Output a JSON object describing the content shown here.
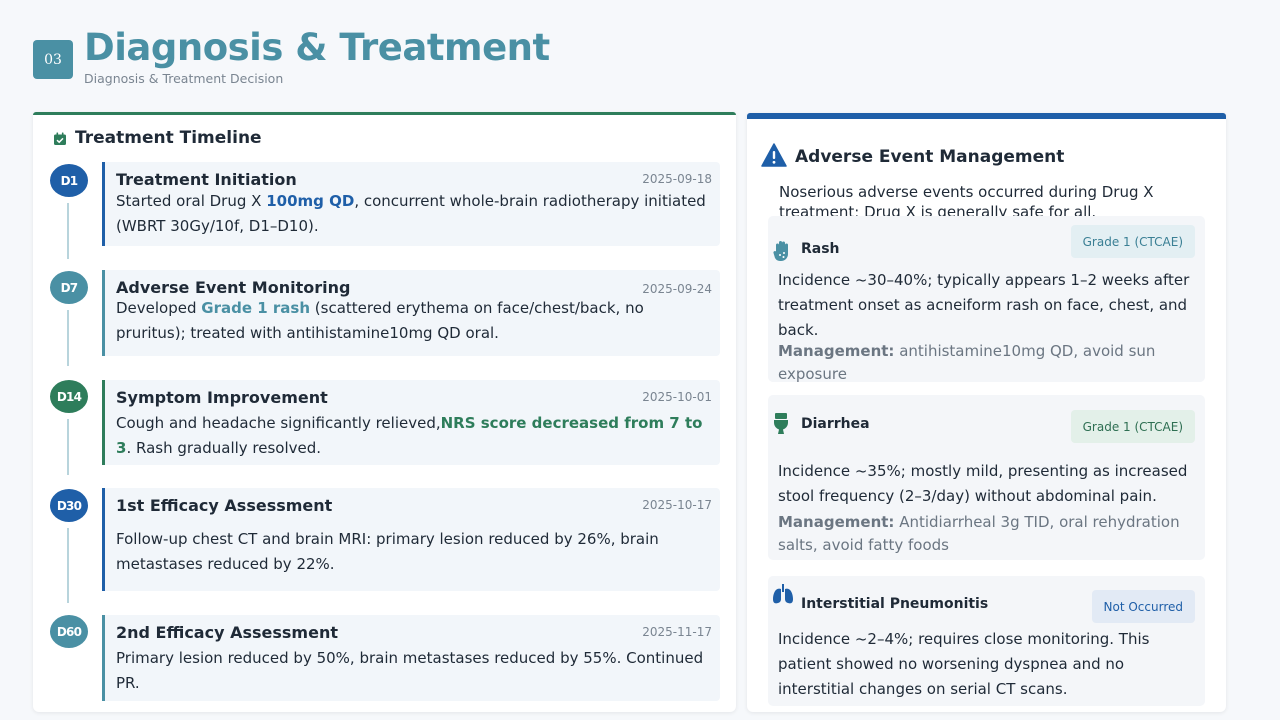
{
  "header": {
    "section_number": "03",
    "title": "Diagnosis & Treatment",
    "subtitle": "Diagnosis & Treatment Decision"
  },
  "timeline": {
    "title": "Treatment Timeline",
    "items": [
      {
        "day": "D1",
        "title": "Treatment Initiation",
        "date": "2025-09-18",
        "text_before": "Started oral Drug X ",
        "highlight": "100mg QD",
        "text_after": ", concurrent whole-brain radiotherapy initiated (WBRT 30Gy/10f, D1–D10)."
      },
      {
        "day": "D7",
        "title": "Adverse Event Monitoring",
        "date": "2025-09-24",
        "text_before": "Developed ",
        "highlight": "Grade 1 rash",
        "text_after": " (scattered erythema on face/chest/back, no pruritus); treated with antihistamine10mg QD oral."
      },
      {
        "day": "D14",
        "title": "Symptom Improvement",
        "date": "2025-10-01",
        "text_before": "Cough and headache significantly relieved,",
        "highlight": "NRS score decreased from 7 to 3",
        "text_after": ". Rash gradually resolved."
      },
      {
        "day": "D30",
        "title": "1st Efficacy Assessment",
        "date": "2025-10-17",
        "text": "Follow-up chest CT and brain MRI: primary lesion reduced by 26%, brain metastases reduced by 22%."
      },
      {
        "day": "D60",
        "title": "2nd Efficacy Assessment",
        "date": "2025-11-17",
        "text": "Primary lesion reduced by 50%, brain metastases reduced by 55%. Continued PR."
      }
    ]
  },
  "adverse": {
    "title": "Adverse Event Management",
    "intro": "Noserious adverse events occurred during Drug X treatment; Drug X is generally safe for all.",
    "events": [
      {
        "name": "Rash",
        "grade": "Grade 1 (CTCAE)",
        "incidence": "Incidence ~30–40%; typically appears 1–2 weeks after treatment onset as acneiform rash on face, chest, and back.",
        "mgmt_label": "Management:",
        "mgmt_text": " antihistamine10mg QD, avoid sun exposure"
      },
      {
        "name": "Diarrhea",
        "grade": "Grade 1 (CTCAE)",
        "incidence": "Incidence ~35%; mostly mild, presenting as increased stool frequency (2–3/day) without abdominal pain.",
        "mgmt_label": "Management:",
        "mgmt_text": " Antidiarrheal 3g TID, oral rehydration salts, avoid fatty foods"
      },
      {
        "name": "Interstitial Pneumonitis",
        "grade": "Not Occurred",
        "incidence": "Incidence ~2–4%; requires close monitoring. This patient showed no worsening dyspnea and no interstitial changes on serial CT scans."
      }
    ]
  },
  "colors": {
    "teal": "#4a90a4",
    "navy": "#1f5fa8",
    "green": "#2e7d5b"
  }
}
